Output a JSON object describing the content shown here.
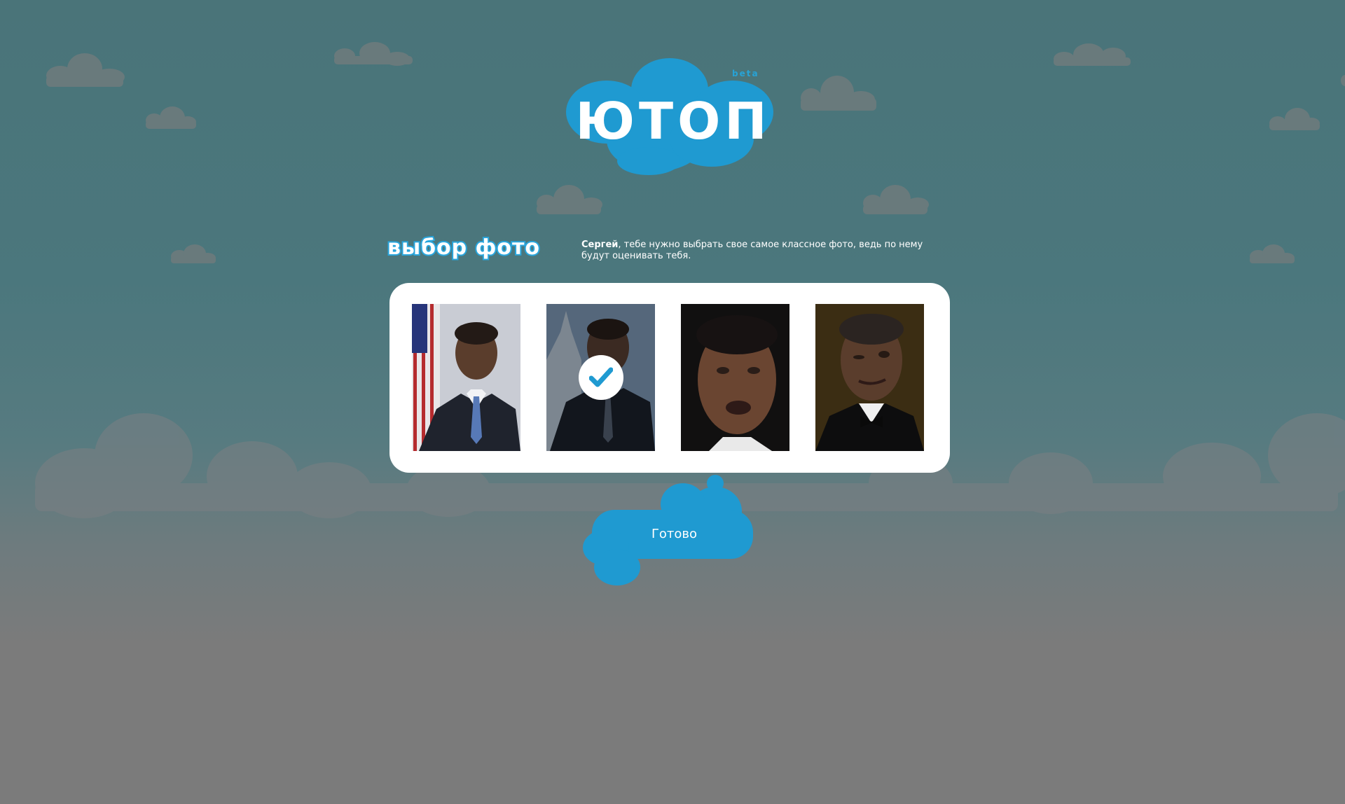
{
  "app": {
    "logo_text": "ЮТОП",
    "logo_badge": "beta",
    "brand_color": "#1f9ad1"
  },
  "page": {
    "title": "выбор фото",
    "intro_name": "Сергей",
    "intro_text": ", тебе нужно выбрать свое самое классное фото, ведь по нему будут оценивать тебя."
  },
  "photos": [
    {
      "label": "photo-1",
      "selected": false
    },
    {
      "label": "photo-2",
      "selected": true
    },
    {
      "label": "photo-3",
      "selected": false
    },
    {
      "label": "photo-4",
      "selected": false
    }
  ],
  "actions": {
    "done_label": "Готово"
  }
}
